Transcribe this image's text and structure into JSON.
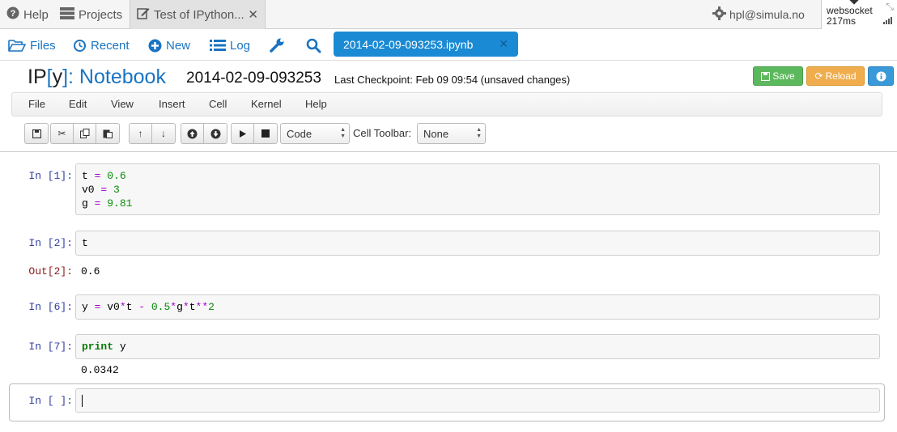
{
  "topbar": {
    "help_label": "Help",
    "projects_label": "Projects",
    "notebook_tab_label": "Test of IPython...",
    "close_glyph": "✕",
    "user_label": "hpl@simula.no",
    "websocket_label": "websocket",
    "latency_label": "217ms"
  },
  "navbar": {
    "files_label": "Files",
    "recent_label": "Recent",
    "new_label": "New",
    "log_label": "Log",
    "open_file_tab": "2014-02-09-093253.ipynb",
    "close_glyph": "✕"
  },
  "header": {
    "logo_ip": "IP",
    "logo_bracket_open": "[",
    "logo_y": "y",
    "logo_bracket_close": "]",
    "logo_rest": ": Notebook",
    "notebook_name": "2014-02-09-093253",
    "checkpoint": "Last Checkpoint: Feb 09 09:54 (unsaved changes)",
    "save_label": "Save",
    "reload_label": "Reload",
    "info_glyph": "i"
  },
  "menubar": [
    "File",
    "Edit",
    "View",
    "Insert",
    "Cell",
    "Kernel",
    "Help"
  ],
  "toolbar": {
    "cell_type": "Code",
    "cell_toolbar_label": "Cell Toolbar:",
    "cell_toolbar_value": "None"
  },
  "cells": {
    "c1": {
      "prompt": "In [1]:"
    },
    "c2": {
      "prompt": "In [2]:",
      "code": "t",
      "out_prompt": "Out[2]:",
      "output": "0.6"
    },
    "c3": {
      "prompt": "In [6]:"
    },
    "c4": {
      "prompt": "In [7]:",
      "output": "0.0342"
    },
    "c5": {
      "prompt": "In [ ]:"
    }
  },
  "colors": {
    "accent_blue": "#1a74c2",
    "tab_blue": "#1a8ad4",
    "save_green": "#5cb85c",
    "reload_orange": "#f0ad4e"
  }
}
